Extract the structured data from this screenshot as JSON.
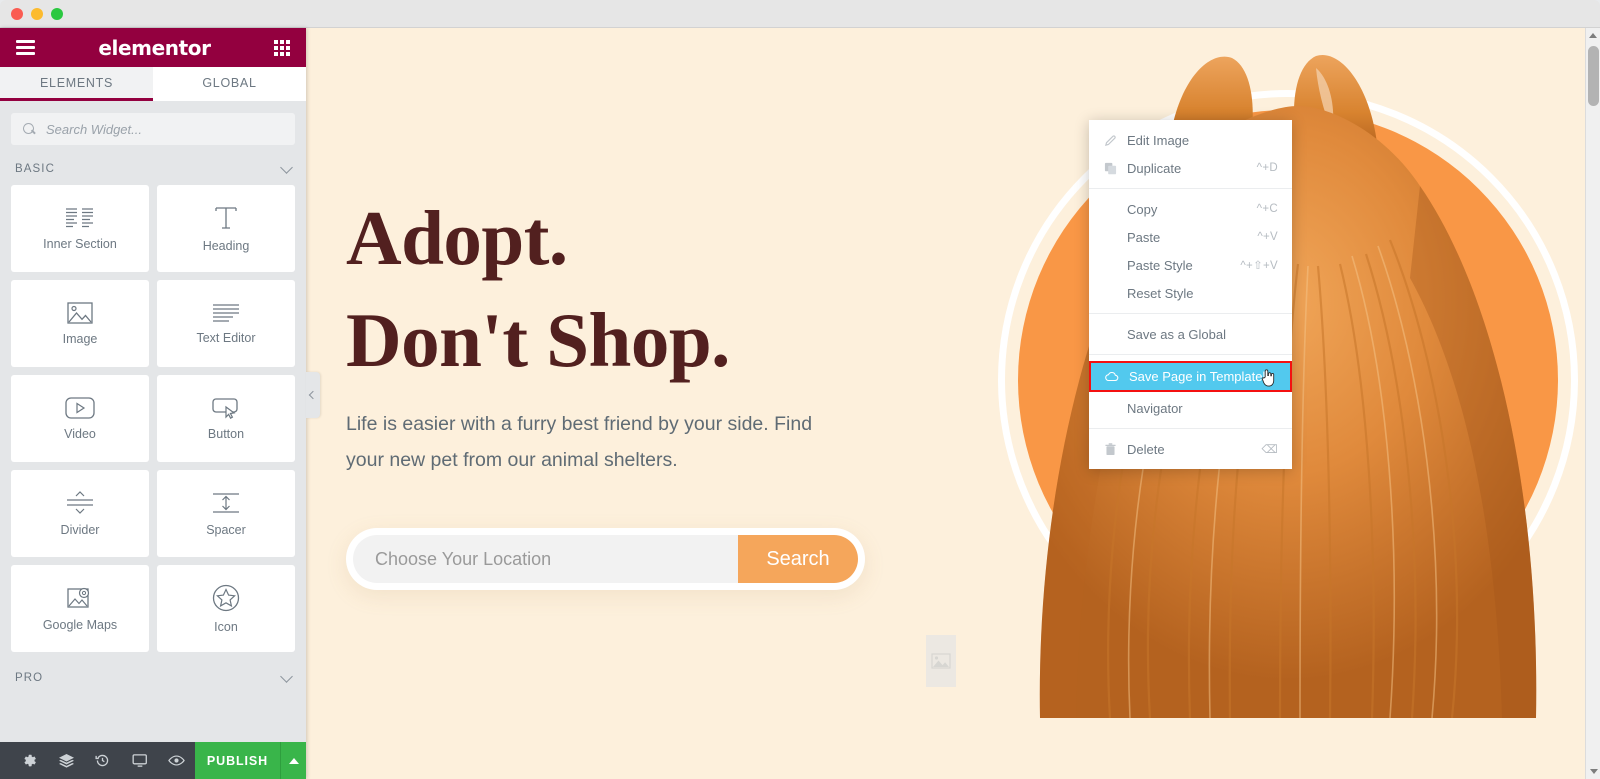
{
  "window": {
    "traffic_lights": [
      "close",
      "minimize",
      "maximize"
    ]
  },
  "panel": {
    "logo": "elementor",
    "menu_icon": "hamburger-icon",
    "grid_icon": "grid-icon",
    "tabs": [
      {
        "label": "ELEMENTS",
        "active": true
      },
      {
        "label": "GLOBAL",
        "active": false
      }
    ],
    "search": {
      "placeholder": "Search Widget...",
      "value": "",
      "icon": "search-icon"
    },
    "sections": [
      {
        "label": "BASIC",
        "expanded": true,
        "chevron": "chevron-down-icon"
      },
      {
        "label": "PRO",
        "expanded": false,
        "chevron": "chevron-down-icon"
      }
    ],
    "widgets": [
      {
        "label": "Inner Section",
        "icon": "inner-section-icon"
      },
      {
        "label": "Heading",
        "icon": "heading-icon"
      },
      {
        "label": "Image",
        "icon": "image-icon"
      },
      {
        "label": "Text Editor",
        "icon": "text-editor-icon"
      },
      {
        "label": "Video",
        "icon": "video-icon"
      },
      {
        "label": "Button",
        "icon": "button-icon"
      },
      {
        "label": "Divider",
        "icon": "divider-icon"
      },
      {
        "label": "Spacer",
        "icon": "spacer-icon"
      },
      {
        "label": "Google Maps",
        "icon": "google-maps-icon"
      },
      {
        "label": "Icon",
        "icon": "star-icon"
      }
    ],
    "bottom_bar": {
      "icons": [
        {
          "name": "settings-gear-icon"
        },
        {
          "name": "navigator-layers-icon"
        },
        {
          "name": "history-revision-icon"
        },
        {
          "name": "responsive-mode-icon"
        },
        {
          "name": "preview-eye-icon"
        }
      ],
      "publish_label": "PUBLISH",
      "publish_arrow_icon": "caret-up-icon"
    },
    "collapse_handle_icon": "chevron-left-icon"
  },
  "canvas": {
    "heading_line1": "Adopt.",
    "heading_line2": "Don't Shop.",
    "subtext": "Life is easier with a furry best friend by your side. Find your new pet from our animal shelters.",
    "location_placeholder": "Choose Your Location",
    "location_value": "",
    "search_button_label": "Search",
    "image_placeholder_icon": "image-placeholder-icon",
    "hero_image_alt": "pomeranian-dog-photo"
  },
  "context_menu": {
    "items": [
      {
        "label": "Edit Image",
        "shortcut": "",
        "icon": "pencil-icon",
        "highlighted": false,
        "separator_after": false
      },
      {
        "label": "Duplicate",
        "shortcut": "^+D",
        "icon": "duplicate-icon",
        "highlighted": false,
        "separator_after": true
      },
      {
        "label": "Copy",
        "shortcut": "^+C",
        "icon": "",
        "highlighted": false,
        "separator_after": false
      },
      {
        "label": "Paste",
        "shortcut": "^+V",
        "icon": "",
        "highlighted": false,
        "separator_after": false
      },
      {
        "label": "Paste Style",
        "shortcut": "^+⇧+V",
        "icon": "",
        "highlighted": false,
        "separator_after": false
      },
      {
        "label": "Reset Style",
        "shortcut": "",
        "icon": "",
        "highlighted": false,
        "separator_after": true
      },
      {
        "label": "Save as a Global",
        "shortcut": "",
        "icon": "",
        "highlighted": false,
        "separator_after": true
      },
      {
        "label": "Save Page in Templately",
        "shortcut": "",
        "icon": "cloud-icon",
        "highlighted": true,
        "separator_after": false
      },
      {
        "label": "Navigator",
        "shortcut": "",
        "icon": "",
        "highlighted": false,
        "separator_after": true
      },
      {
        "label": "Delete",
        "shortcut": "⌫",
        "icon": "trash-icon",
        "highlighted": false,
        "separator_after": false
      }
    ],
    "cursor_icon": "pointing-hand-cursor"
  },
  "scrollbar": {
    "up_icon": "scroll-up-arrow",
    "down_icon": "scroll-down-arrow",
    "thumb_position": "near-top"
  },
  "colors": {
    "brand_maroon": "#93003f",
    "canvas_cream": "#fdf0dc",
    "heading_maroon": "#52201f",
    "accent_orange": "#f5a65b",
    "circle_orange": "#f99746",
    "publish_green": "#39b54a",
    "highlight_cyan": "#52c9ee",
    "highlight_border_red": "#f41010",
    "panel_gray": "#e4e6e8",
    "bottom_bar_dark": "#3f444b"
  }
}
